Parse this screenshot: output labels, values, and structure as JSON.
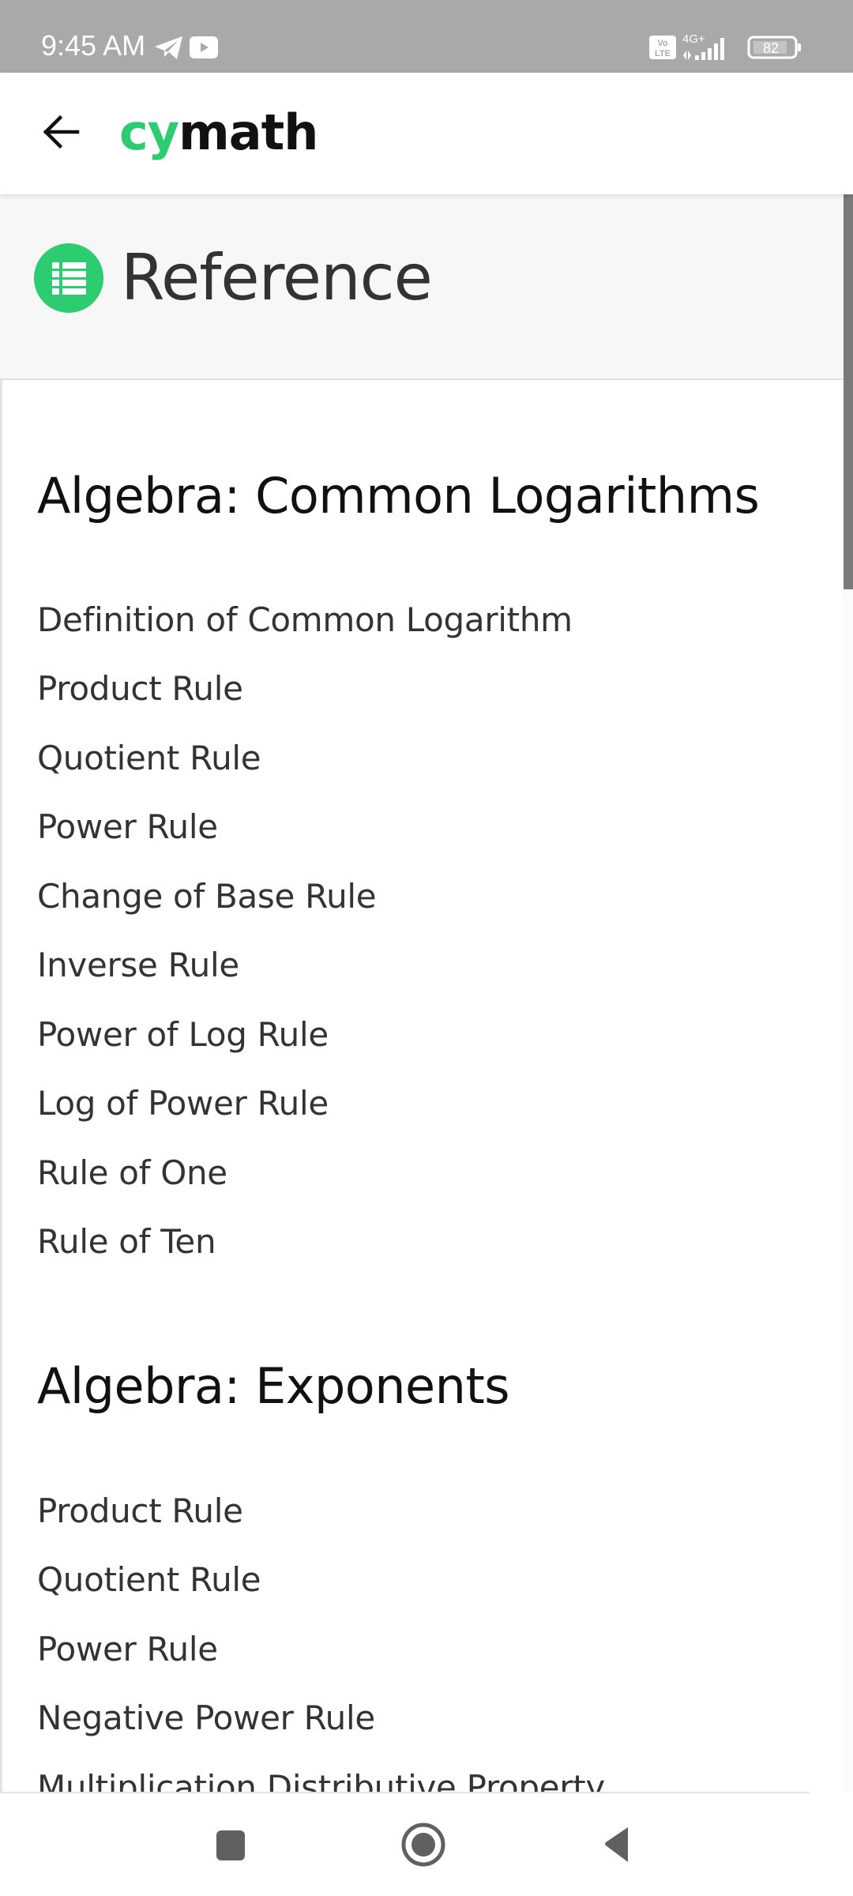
{
  "status_bar": {
    "time": "9:45 AM",
    "notification_icons": [
      "telegram-icon",
      "youtube-icon"
    ],
    "network_label": "4G+",
    "volte_label": "Vo LTE",
    "battery_level": "82"
  },
  "app_bar": {
    "back_icon": "arrow-left-icon",
    "logo_part1": "cy",
    "logo_part2": "math",
    "brand_color": "#2ecc71"
  },
  "page": {
    "icon": "list-icon",
    "title": "Reference"
  },
  "sections": [
    {
      "heading": "Algebra: Common Logarithms",
      "items": [
        "Definition of Common Logarithm",
        "Product Rule",
        "Quotient Rule",
        "Power Rule",
        "Change of Base Rule",
        "Inverse Rule",
        "Power of Log Rule",
        "Log of Power Rule",
        "Rule of One",
        "Rule of Ten"
      ]
    },
    {
      "heading": "Algebra: Exponents",
      "items": [
        "Product Rule",
        "Quotient Rule",
        "Power Rule",
        "Negative Power Rule",
        "Multiplication Distributive Property"
      ]
    }
  ],
  "nav_bar": {
    "buttons": [
      "recents-square-icon",
      "home-circle-icon",
      "back-triangle-icon"
    ]
  }
}
